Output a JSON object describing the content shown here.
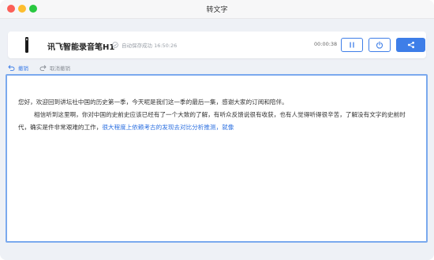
{
  "window": {
    "title": "转文字"
  },
  "header": {
    "device_name": "讯飞智能录音笔H1",
    "autosave_text": "自动保存成功 16:50:26",
    "timer": "00:00:38",
    "icons": {
      "device": "recorder-pen-icon",
      "autosave": "check-circle-icon",
      "pause": "pause-icon",
      "power": "power-icon",
      "share": "share-icon"
    }
  },
  "toolbar": {
    "undo_label": "撤销",
    "cancel_label": "取消撤销"
  },
  "editor": {
    "line1": "您好，欢迎回到讲坛社中国的历史第一季，今天呢是我们这一季的最后一集，感谢大家的订阅和陪伴。",
    "para2_main": "相信听到这里啊，你对中国的史前史应该已经有了一个大致的了解，有听众反馈说很有收获，也有人觉得听得很辛苦，了解没有文字的史前时代，确实是件非常艰难的工作，",
    "para2_highlight": "很大程度上依赖考古的发现去对比分析推测，就像"
  },
  "colors": {
    "accent": "#3e7ee8",
    "highlight_text": "#2b6fe0",
    "editor_border": "#7aa9ee"
  }
}
